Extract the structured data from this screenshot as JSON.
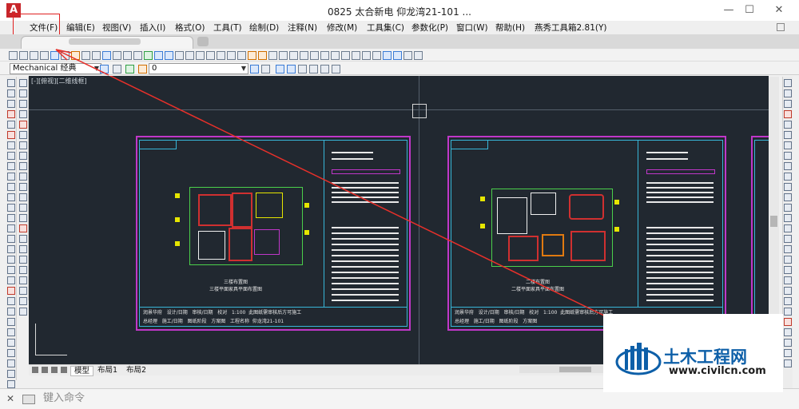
{
  "window": {
    "title": "0825 太合新电  仰龙湾21-101  ...",
    "app_icon_letter": "A",
    "min_symbol": "—",
    "max_symbol": "☐",
    "close_symbol": "✕"
  },
  "menu": {
    "items": [
      "文件(F)",
      "编辑(E)",
      "视图(V)",
      "插入(I)",
      "格式(O)",
      "工具(T)",
      "绘制(D)",
      "注释(N)",
      "修改(M)",
      "工具集(C)",
      "参数化(P)",
      "窗口(W)",
      "帮助(H)",
      "燕秀工具箱2.81(Y)"
    ],
    "highlighted": "文件(F)",
    "highlight_color": "#e02020"
  },
  "toolbar": {
    "style_select": "Mechanical 经典",
    "layer_select": "0"
  },
  "canvas": {
    "view_label": "[-][俯视][二维线框]",
    "background": "#212830",
    "sheets": [
      {
        "plan_caption_line1": "三楼布置图",
        "plan_caption_line2": "三楼平面家具平面布置图",
        "title_block": [
          "润景华府",
          "设计/日期",
          "审核/日期",
          "校对",
          "1:100",
          "此图纸需审核后方可施工",
          "总经理",
          "施工/日期",
          "图纸阶段",
          "方案图",
          "工程名称",
          "仰龙湾21-101"
        ]
      },
      {
        "plan_caption_line1": "二楼布置图",
        "plan_caption_line2": "二楼平面家具平面布置图",
        "title_block": [
          "润景华府",
          "设计/日期",
          "审核/日期",
          "校对",
          "1:100",
          "此图纸需审核后方可施工",
          "总经理",
          "施工/日期",
          "图纸阶段",
          "方案图",
          "工程名称",
          "仰龙湾21-101"
        ]
      }
    ]
  },
  "layout_tabs": [
    "模型",
    "布局1",
    "布局2"
  ],
  "command": {
    "placeholder": "键入命令"
  },
  "watermark": {
    "title": "土木工程网",
    "url": "www.civilcn.com"
  }
}
